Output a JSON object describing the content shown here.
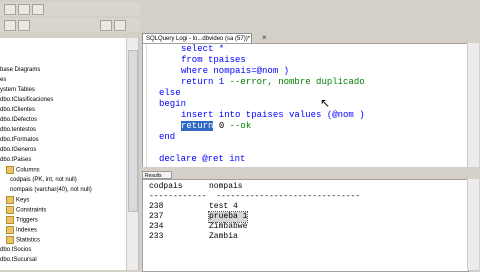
{
  "query_tab": {
    "title": "SQLQuery Logi - lo...dbvideo (sa (57))*"
  },
  "tree": {
    "items": [
      {
        "label": "base Diagrams"
      },
      {
        "label": "es"
      },
      {
        "label": "ystem Tables"
      },
      {
        "label": "dbo.tClasificaciones"
      },
      {
        "label": "dbo.tClientes"
      },
      {
        "label": "dbo.tDefectos"
      },
      {
        "label": "dbo.tentestos"
      },
      {
        "label": "dbo.tFormatos"
      },
      {
        "label": "dbo.tGeneros"
      },
      {
        "label": "dbo.tPaises"
      },
      {
        "label": "Columns"
      },
      {
        "label": "codpais (PK, int, not null)"
      },
      {
        "label": "nompais (varchar(40), not null)"
      },
      {
        "label": "Keys"
      },
      {
        "label": "Constraints"
      },
      {
        "label": "Triggers"
      },
      {
        "label": "Indexes"
      },
      {
        "label": "Statistics"
      },
      {
        "label": "dbo.tSocios"
      },
      {
        "label": "dbo.tSucursal"
      }
    ]
  },
  "code": {
    "l1": "select *",
    "l2": "from tpaises",
    "l3a": "where nompais=@nom )",
    "l4a": "return 1",
    "l4b": "--error, nombre duplicado",
    "l5": "else",
    "l6": "begin",
    "l7a": "insert into tpaises values (@nom )",
    "l8a": "return",
    "l8b": "0",
    "l8c": "--ok",
    "l9": "end",
    "l10": "declare @ret int"
  },
  "results": {
    "tab_label": "Results",
    "headers": [
      "codpais",
      "nompais"
    ],
    "separator": "------------  ------------------------------",
    "rows": [
      {
        "codpais": "238",
        "nompais": "test 4"
      },
      {
        "codpais": "237",
        "nompais": "prueba 1"
      },
      {
        "codpais": "234",
        "nompais": "Zimbabwe"
      },
      {
        "codpais": "233",
        "nompais": "Zambia"
      }
    ]
  },
  "colors": {
    "keyword": "#0000ff",
    "comment": "#008000",
    "selection": "#316ac5"
  }
}
